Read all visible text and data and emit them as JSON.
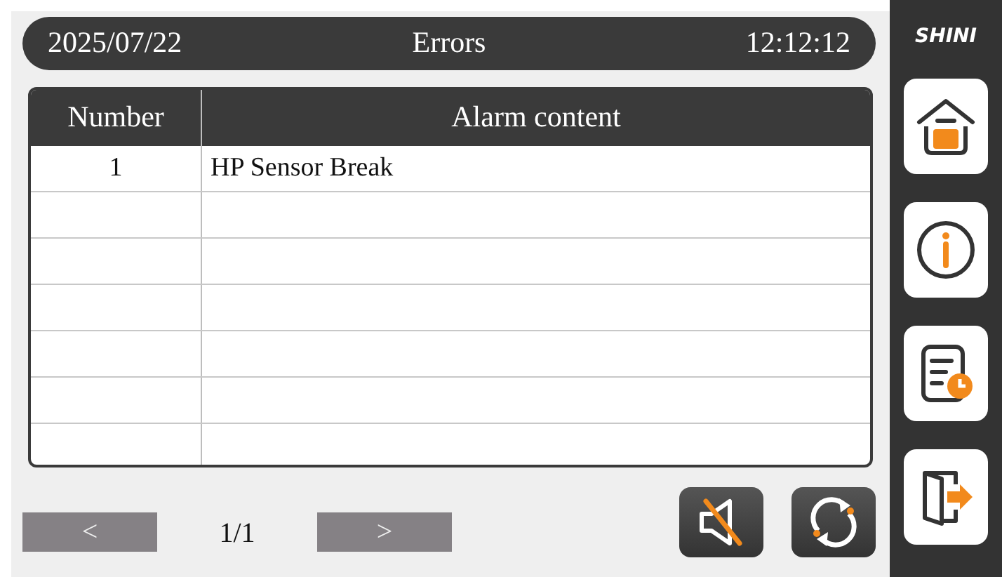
{
  "header": {
    "date": "2025/07/22",
    "title": "Errors",
    "time": "12:12:12"
  },
  "table": {
    "columns": [
      "Number",
      "Alarm content"
    ],
    "rows": [
      {
        "number": "1",
        "content": "HP Sensor Break"
      }
    ]
  },
  "pager": {
    "prev": "<",
    "page": "1/1",
    "next": ">"
  },
  "sidebar": {
    "logo": "SHINI"
  }
}
